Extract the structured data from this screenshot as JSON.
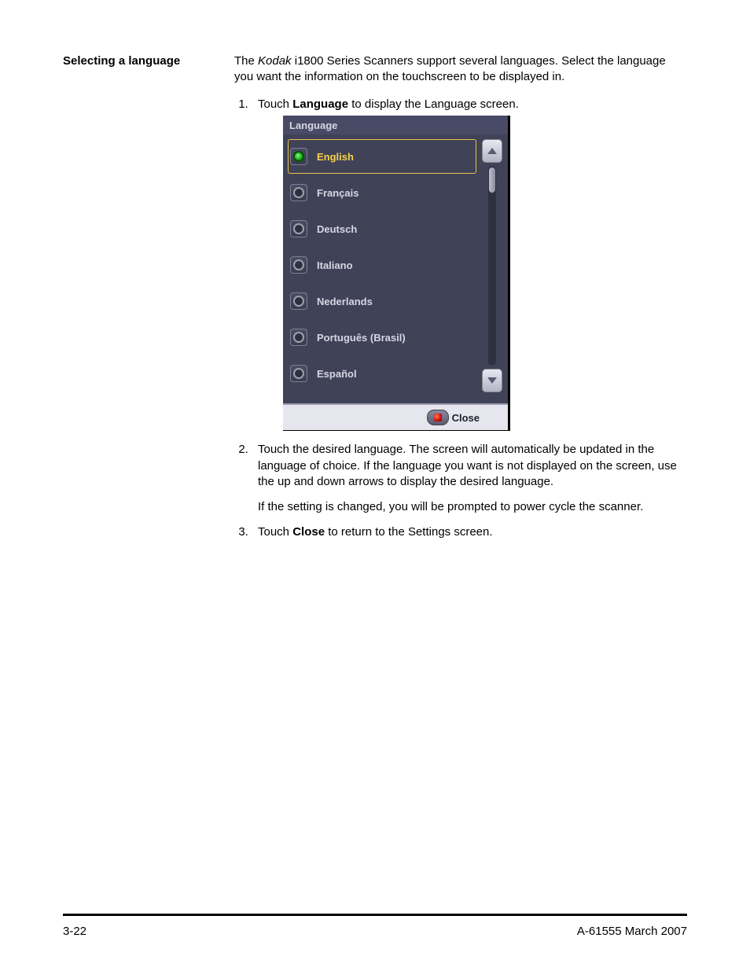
{
  "heading": "Selecting a language",
  "intro": {
    "pre": "The ",
    "italic": "Kodak",
    "post": " i1800 Series Scanners support several languages. Select the language you want the information on the touchscreen to be displayed in."
  },
  "step1": {
    "pre": "Touch ",
    "bold": "Language",
    "post": " to display the Language screen."
  },
  "touchscreen": {
    "title": "Language",
    "languages": [
      {
        "label": "English",
        "selected": true
      },
      {
        "label": "Français",
        "selected": false
      },
      {
        "label": "Deutsch",
        "selected": false
      },
      {
        "label": "Italiano",
        "selected": false
      },
      {
        "label": "Nederlands",
        "selected": false
      },
      {
        "label": "Português (Brasil)",
        "selected": false
      },
      {
        "label": "Español",
        "selected": false
      }
    ],
    "close": "Close"
  },
  "step2": {
    "text": "Touch the desired language. The screen will automatically be updated in the language of choice. If the language you want is not displayed on the screen, use the up and down arrows to display the desired language.",
    "sub": "If the setting is changed, you will be prompted to power cycle the scanner."
  },
  "step3": {
    "pre": "Touch ",
    "bold": "Close",
    "post": " to return to the Settings screen."
  },
  "footer": {
    "left": "3-22",
    "right": "A-61555  March 2007"
  }
}
